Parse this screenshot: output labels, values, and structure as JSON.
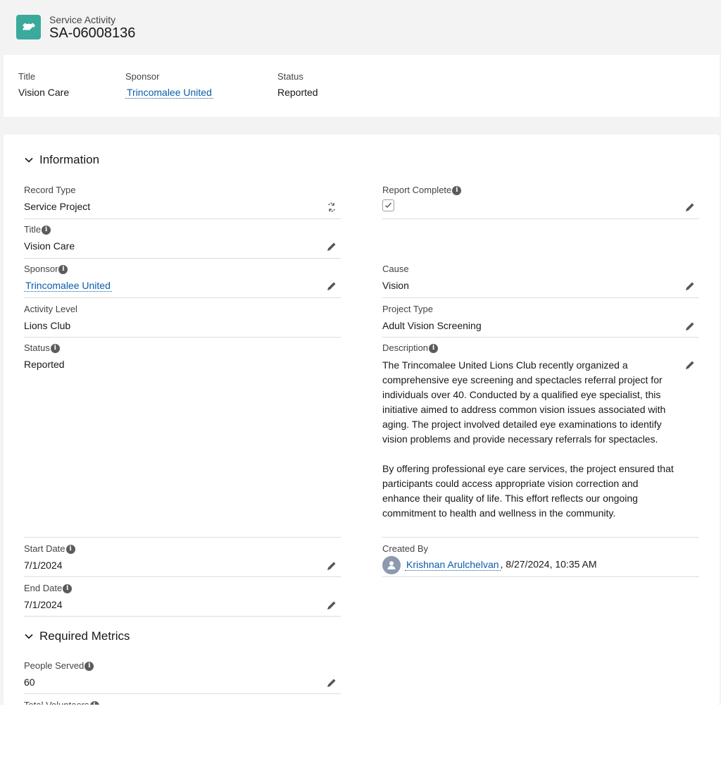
{
  "header": {
    "object_type": "Service Activity",
    "record_name": "SA-06008136"
  },
  "highlights": {
    "title_label": "Title",
    "title_value": "Vision Care",
    "sponsor_label": "Sponsor",
    "sponsor_value": "Trincomalee United",
    "status_label": "Status",
    "status_value": "Reported"
  },
  "information": {
    "section_title": "Information",
    "record_type_label": "Record Type",
    "record_type_value": "Service Project",
    "title_label": "Title",
    "title_value": "Vision Care",
    "sponsor_label": "Sponsor",
    "sponsor_value": "Trincomalee United",
    "activity_level_label": "Activity Level",
    "activity_level_value": "Lions Club",
    "status_label": "Status",
    "status_value": "Reported",
    "start_date_label": "Start Date",
    "start_date_value": "7/1/2024",
    "end_date_label": "End Date",
    "end_date_value": "7/1/2024",
    "report_complete_label": "Report Complete",
    "report_complete_checked": true,
    "cause_label": "Cause",
    "cause_value": "Vision",
    "project_type_label": "Project Type",
    "project_type_value": "Adult Vision Screening",
    "description_label": "Description",
    "description_p1": "The Trincomalee United Lions Club recently organized a comprehensive eye screening and spectacles referral project for individuals over 40. Conducted by a qualified eye specialist, this initiative aimed to address common vision issues associated with aging. The project involved detailed eye examinations to identify vision problems and provide necessary referrals for spectacles.",
    "description_p2": "By offering professional eye care services, the project ensured that participants could access appropriate vision correction and enhance their quality of life. This effort reflects our ongoing commitment to health and wellness in the community.",
    "created_by_label": "Created By",
    "created_by_user": "Krishnan Arulchelvan",
    "created_by_date": ", 8/27/2024, 10:35 AM"
  },
  "metrics": {
    "section_title": "Required Metrics",
    "people_served_label": "People Served",
    "people_served_value": "60",
    "total_volunteers_label": "Total Volunteers"
  },
  "colors": {
    "brand_icon": "#3ba99c",
    "link": "#0b5cab",
    "page_bg": "#f3f3f3"
  }
}
